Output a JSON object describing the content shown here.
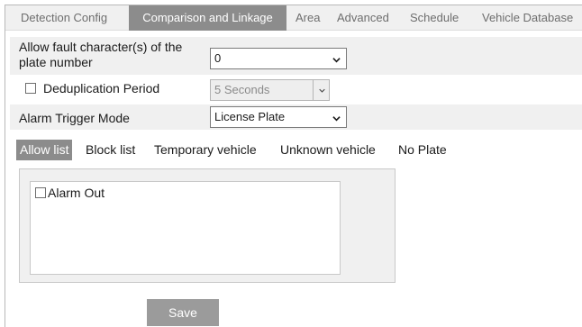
{
  "tabs": [
    {
      "label": "Detection Config",
      "active": false
    },
    {
      "label": "Comparison and Linkage",
      "active": true
    },
    {
      "label": "Area",
      "active": false
    },
    {
      "label": "Advanced",
      "active": false
    },
    {
      "label": "Schedule",
      "active": false
    },
    {
      "label": "Vehicle Database",
      "active": false
    }
  ],
  "form": {
    "fault_label": "Allow fault character(s) of the plate number",
    "fault_label_line1": "Allow fault character(s) of the",
    "fault_label_line2": "plate number",
    "fault_value": "0",
    "dedup_label": "Deduplication Period",
    "dedup_checked": false,
    "dedup_value": "5 Seconds",
    "alarm_label": "Alarm Trigger Mode",
    "alarm_value": "License Plate"
  },
  "list_tabs": [
    {
      "label": "Allow list",
      "active": true
    },
    {
      "label": "Block list",
      "active": false
    },
    {
      "label": "Temporary vehicle",
      "active": false
    },
    {
      "label": "Unknown vehicle",
      "active": false
    },
    {
      "label": "No Plate",
      "active": false
    }
  ],
  "panel": {
    "alarm_out_label": "Alarm Out",
    "alarm_out_checked": false
  },
  "save_label": "Save",
  "colors": {
    "active_tab": "#8c8c8c",
    "row_shade": "#f0f0f0",
    "save_button": "#9b9b9b"
  }
}
